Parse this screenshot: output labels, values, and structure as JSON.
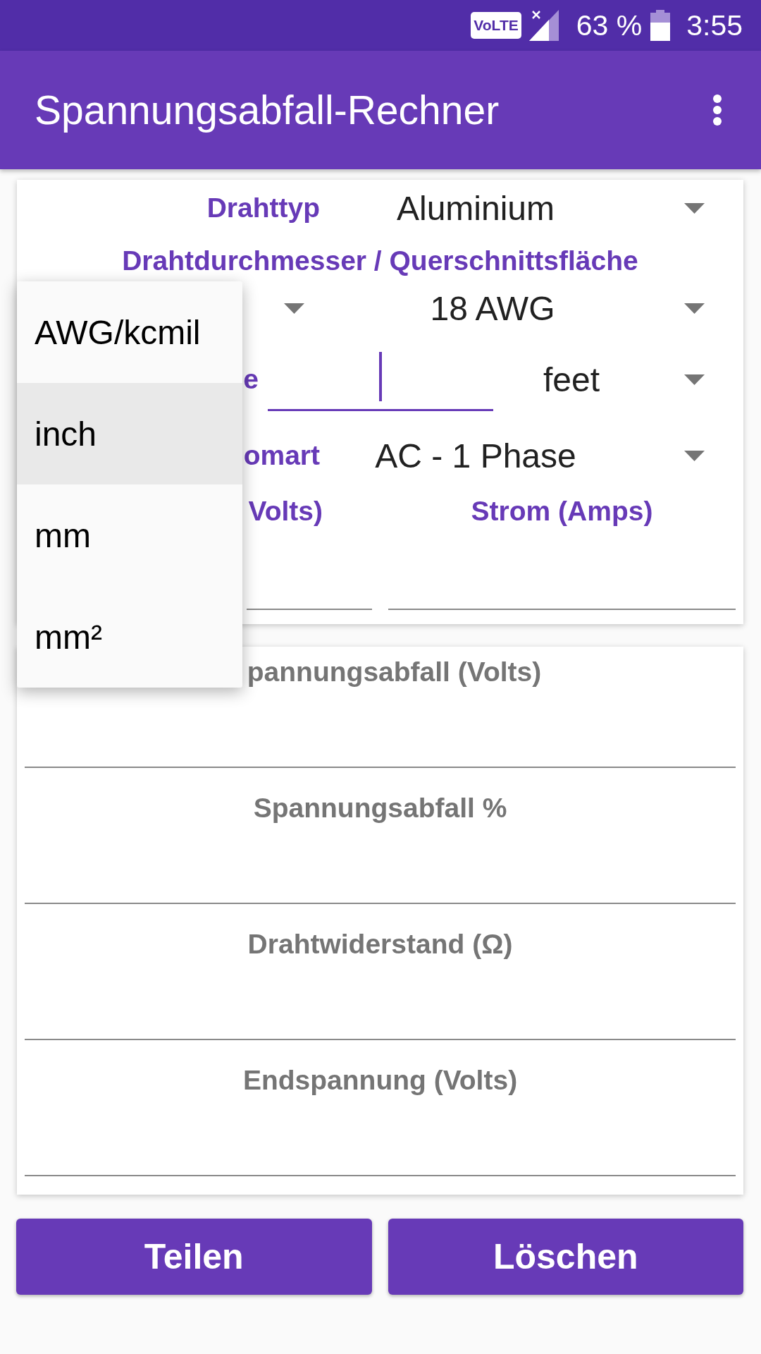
{
  "status_bar": {
    "badge": "VoLTE",
    "battery": "63 %",
    "time": "3:55"
  },
  "app_bar": {
    "title": "Spannungsabfall-Rechner"
  },
  "input_card": {
    "rows": [
      {
        "kind": "spinner",
        "label": "Drahttyp",
        "value": "Aluminium"
      },
      {
        "kind": "heading",
        "label": "Drahtdurchmesser / Querschnittsfläche"
      },
      {
        "kind": "spinner_pair",
        "value": "18 AWG"
      },
      {
        "kind": "text_input",
        "label": "e",
        "unit": "feet",
        "focused": true
      },
      {
        "kind": "spinner",
        "label": "omart",
        "value": "AC - 1 Phase"
      },
      {
        "kind": "label_pair",
        "labels": [
          "Volts)",
          "Strom (Amps)"
        ]
      },
      {
        "kind": "input_pair"
      }
    ]
  },
  "dropdown": {
    "items": [
      {
        "label": "AWG/kcmil",
        "selected": false
      },
      {
        "label": "inch",
        "selected": true
      },
      {
        "label": "mm",
        "selected": false
      },
      {
        "label": "mm²",
        "selected": false
      }
    ]
  },
  "results_card": {
    "fields": [
      {
        "label": "pannungsabfall (Volts)"
      },
      {
        "label": "Spannungsabfall %"
      },
      {
        "label": "Drahtwiderstand (Ω)"
      },
      {
        "label": "Endspannung (Volts)"
      }
    ]
  },
  "buttons": [
    {
      "label": "Teilen"
    },
    {
      "label": "Löschen"
    }
  ]
}
